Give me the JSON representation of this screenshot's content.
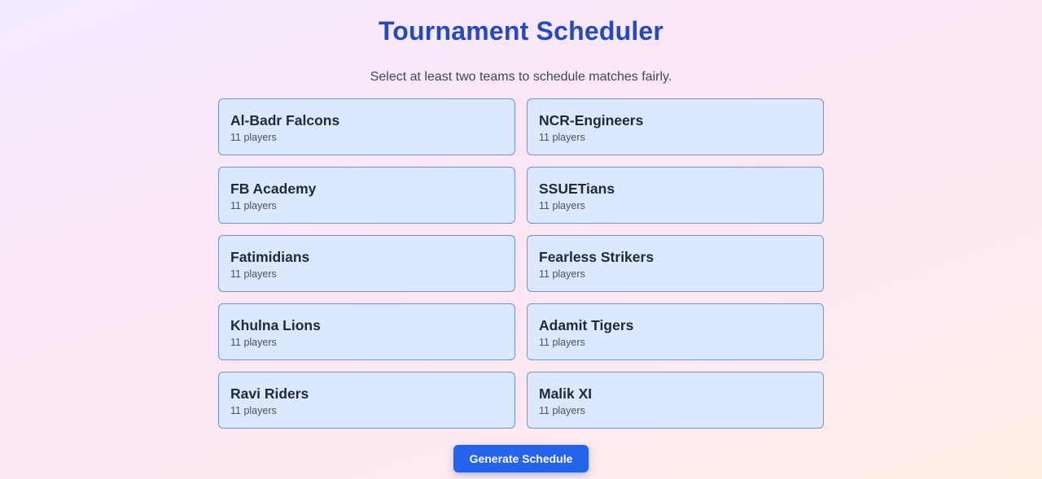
{
  "header": {
    "title": "Tournament Scheduler",
    "subtitle": "Select at least two teams to schedule matches fairly."
  },
  "teams": [
    {
      "name": "Al-Badr Falcons",
      "players": "11 players"
    },
    {
      "name": "NCR-Engineers",
      "players": "11 players"
    },
    {
      "name": "FB Academy",
      "players": "11 players"
    },
    {
      "name": "SSUETians",
      "players": "11 players"
    },
    {
      "name": "Fatimidians",
      "players": "11 players"
    },
    {
      "name": "Fearless Strikers",
      "players": "11 players"
    },
    {
      "name": "Khulna Lions",
      "players": "11 players"
    },
    {
      "name": "Adamit Tigers",
      "players": "11 players"
    },
    {
      "name": "Ravi Riders",
      "players": "11 players"
    },
    {
      "name": "Malik XI",
      "players": "11 players"
    }
  ],
  "actions": {
    "generate_label": "Generate Schedule"
  },
  "colors": {
    "title": "#2449c4",
    "card_background": "#dbe8fd",
    "card_border": "#6f92d8",
    "button_background": "#2563eb"
  }
}
